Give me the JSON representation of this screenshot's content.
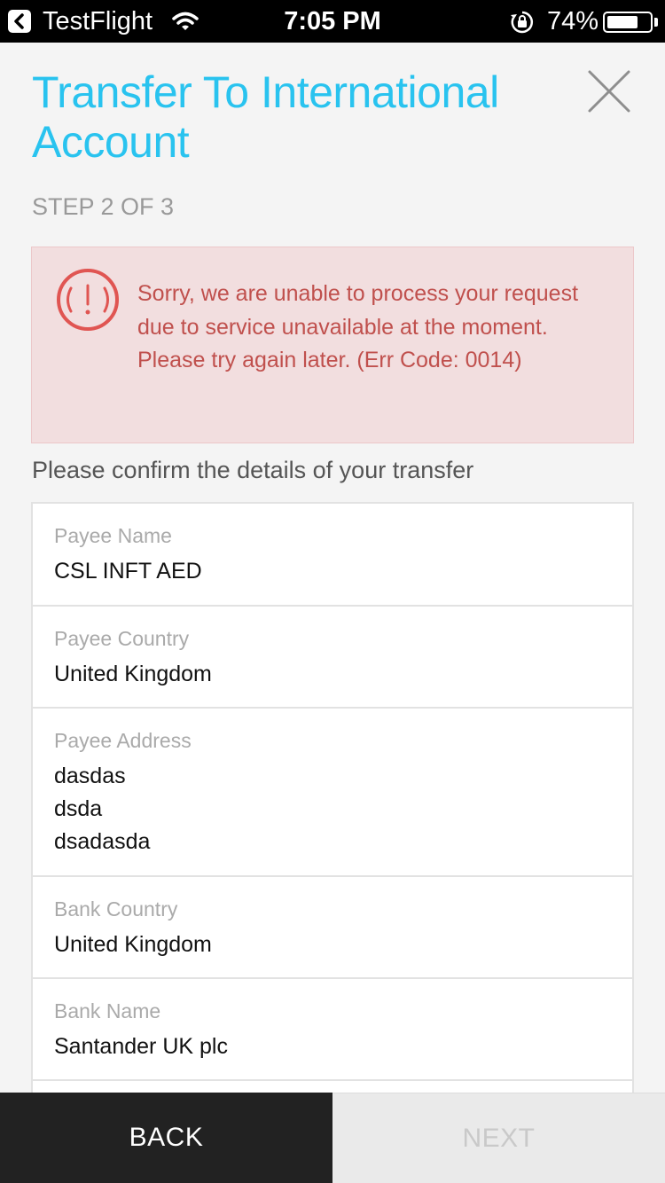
{
  "status_bar": {
    "back_app": "TestFlight",
    "time": "7:05 PM",
    "battery_pct": "74%",
    "battery_level": 0.74,
    "icons": [
      "back-arrow-icon",
      "wifi-icon",
      "rotation-lock-icon",
      "battery-icon"
    ]
  },
  "header": {
    "title": "Transfer To International Account",
    "step": "STEP 2 OF 3",
    "close_icon": "close-icon",
    "accent_color": "#29c3ef"
  },
  "alert": {
    "icon": "error-icon",
    "message": "Sorry, we are unable to process your request due to service unavailable at the moment. Please try again later. (Err Code: 0014)",
    "text_color": "#c0504d",
    "background_color": "#f2dedf"
  },
  "intro": "Please confirm the details of your transfer",
  "details": [
    {
      "label": "Payee Name",
      "value": [
        "CSL INFT AED"
      ]
    },
    {
      "label": "Payee Country",
      "value": [
        "United Kingdom"
      ]
    },
    {
      "label": "Payee Address",
      "value": [
        "dasdas",
        "dsda",
        "dsadasda"
      ]
    },
    {
      "label": "Bank Country",
      "value": [
        "United Kingdom"
      ]
    },
    {
      "label": "Bank Name",
      "value": [
        "Santander UK plc"
      ]
    }
  ],
  "footer": {
    "back_label": "BACK",
    "next_label": "NEXT"
  }
}
